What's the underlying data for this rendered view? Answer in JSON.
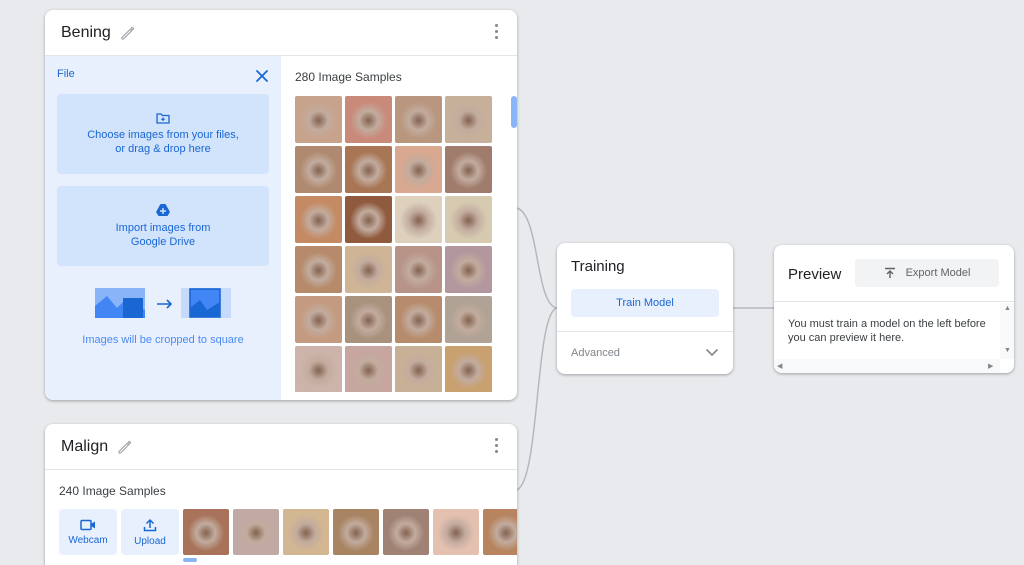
{
  "colors": {
    "accent": "#1967d2",
    "panel_blue": "#e8f0fe",
    "button_blue": "#d2e3fc",
    "background": "#e8eaed"
  },
  "classes": [
    {
      "name": "Bening",
      "upload_panel": {
        "file_label": "File",
        "choose_line1": "Choose images from your files,",
        "choose_line2": "or drag & drop here",
        "drive_line1": "Import images from",
        "drive_line2": "Google Drive",
        "crop_notice": "Images will be cropped to square"
      },
      "samples_label": "280 Image Samples",
      "thumb_colors": [
        "#c7a38c",
        "#c98a7a",
        "#b9967e",
        "#c6b09a",
        "#b08a70",
        "#a87654",
        "#d8a890",
        "#a07c6c",
        "#c48a64",
        "#8f5a3e",
        "#ddd0bc",
        "#d6cab0",
        "#b68a6a",
        "#cfb596",
        "#b89488",
        "#b2989e",
        "#c49b80",
        "#a8927e",
        "#b68c6c",
        "#b0a294",
        "#cdb4aa",
        "#c7a6a0",
        "#c8b096",
        "#c9a070"
      ]
    },
    {
      "name": "Malign",
      "samples_label": "240 Image Samples",
      "webcam_label": "Webcam",
      "upload_label": "Upload",
      "thumb_colors": [
        "#a8735a",
        "#c2aaa4",
        "#d3b692",
        "#a88462",
        "#a08274",
        "#e4c0b0",
        "#b88460"
      ]
    }
  ],
  "training": {
    "title": "Training",
    "train_button": "Train Model",
    "advanced_label": "Advanced"
  },
  "preview": {
    "title": "Preview",
    "export_button": "Export Model",
    "message": "You must train a model on the left before you can preview it here."
  },
  "icons": [
    "pencil-icon",
    "kebab-menu-icon",
    "close-icon",
    "add-folder-icon",
    "google-drive-icon",
    "arrow-right-icon",
    "webcam-icon",
    "upload-icon",
    "chevron-down-icon",
    "export-icon"
  ]
}
